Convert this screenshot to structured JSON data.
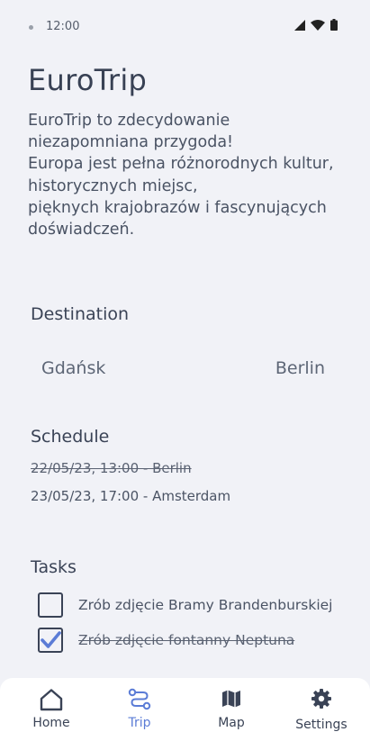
{
  "status_bar": {
    "time": "12:00"
  },
  "app": {
    "title": "EuroTrip",
    "intro": "EuroTrip to zdecydowanie\nniezapomniana przygoda!\nEuropa jest pełna różnorodnych kultur,\nhistorycznych miejsc,\npięknych krajobrazów i fascynujących\ndoświadczeń."
  },
  "destination": {
    "title": "Destination",
    "from": "Gdańsk",
    "to": "Berlin"
  },
  "schedule": {
    "title": "Schedule",
    "items": [
      {
        "text": "22/05/23, 13:00 - Berlin",
        "done": true
      },
      {
        "text": "23/05/23, 17:00 - Amsterdam",
        "done": false
      }
    ]
  },
  "tasks": {
    "title": "Tasks",
    "items": [
      {
        "text": "Zrób zdjęcie Bramy Brandenburskiej",
        "checked": false
      },
      {
        "text": "Zrób zdjęcie fontanny Neptuna",
        "checked": true
      }
    ]
  },
  "nav": {
    "items": [
      {
        "label": "Home",
        "icon": "home-icon",
        "active": false
      },
      {
        "label": "Trip",
        "icon": "route-icon",
        "active": true
      },
      {
        "label": "Map",
        "icon": "map-icon",
        "active": false
      },
      {
        "label": "Settings",
        "icon": "gear-icon",
        "active": false
      }
    ]
  },
  "colors": {
    "background": "#f1f2f7",
    "text": "#3a4356",
    "accent": "#5b7cd6",
    "nav_bg": "#ffffff"
  }
}
